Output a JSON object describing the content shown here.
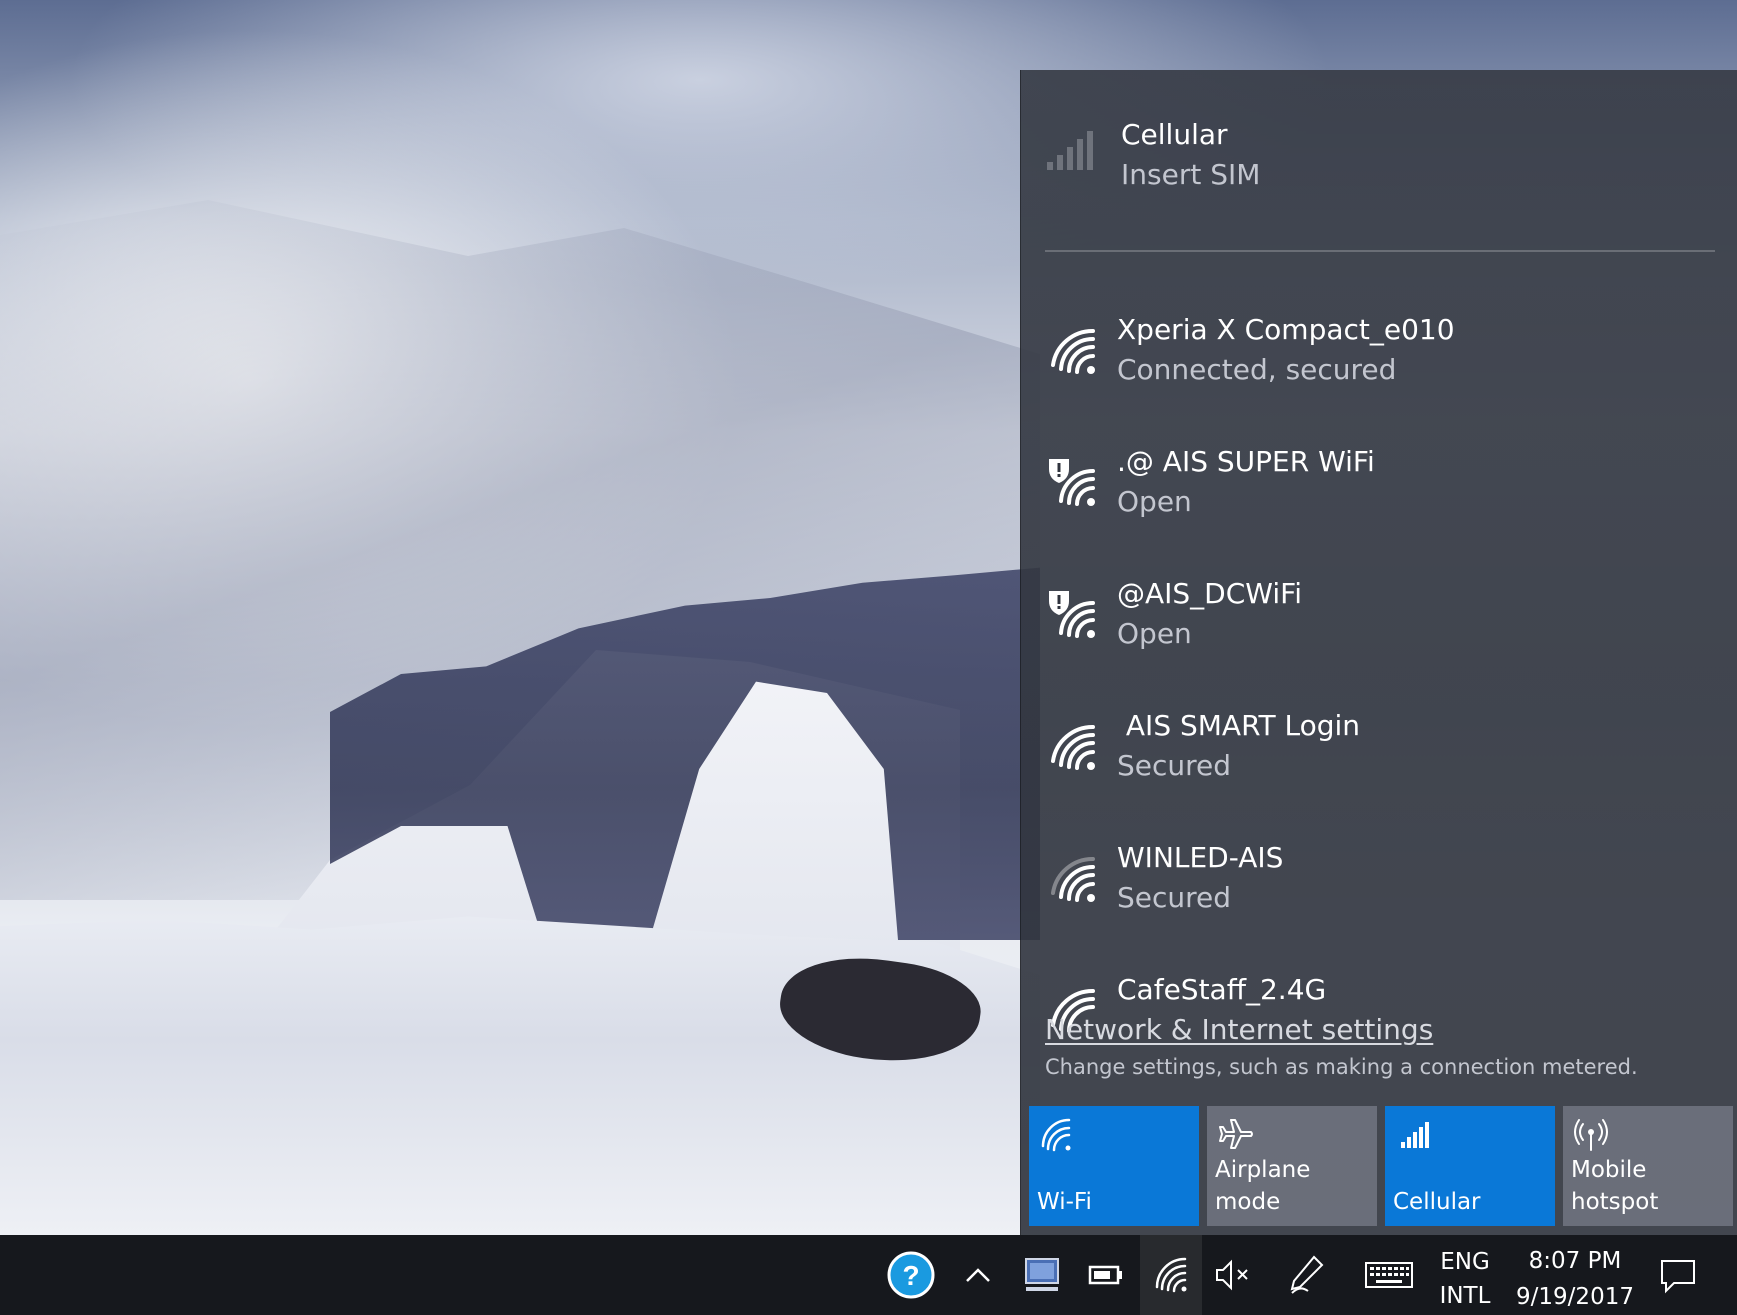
{
  "flyout": {
    "cellular": {
      "name": "Cellular",
      "status": "Insert SIM",
      "icon": "cellular-signal-icon"
    },
    "networks": [
      {
        "name": "Xperia X Compact_e010",
        "status": "Connected, secured",
        "icon": "wifi-icon",
        "warning": false
      },
      {
        "name": ".@ AIS SUPER WiFi",
        "status": "Open",
        "icon": "wifi-open-warning-icon",
        "warning": true
      },
      {
        "name": "@AIS_DCWiFi",
        "status": "Open",
        "icon": "wifi-open-warning-icon",
        "warning": true
      },
      {
        "name": " AIS SMART Login",
        "status": "Secured",
        "icon": "wifi-icon",
        "warning": false
      },
      {
        "name": "WINLED-AIS",
        "status": "Secured",
        "icon": "wifi-icon",
        "warning": false
      },
      {
        "name": "CafeStaff_2.4G",
        "status": "",
        "icon": "wifi-icon",
        "warning": false
      }
    ],
    "settings_link": "Network & Internet settings",
    "settings_desc": "Change settings, such as making a connection metered.",
    "tiles": [
      {
        "label": "Wi-Fi",
        "icon": "wifi-icon",
        "on": true
      },
      {
        "label": "Airplane mode",
        "icon": "airplane-icon",
        "on": false
      },
      {
        "label": "Cellular",
        "icon": "cellular-signal-icon",
        "on": true
      },
      {
        "label": "Mobile hotspot",
        "icon": "hotspot-icon",
        "on": false
      }
    ]
  },
  "taskbar": {
    "icons": [
      "help-icon",
      "chevron-up-icon",
      "display-icon",
      "battery-icon",
      "wifi-icon",
      "volume-muted-icon",
      "pen-icon",
      "keyboard-icon",
      "action-center-icon"
    ],
    "lang_line1": "ENG",
    "lang_line2": "INTL",
    "time": "8:07 PM",
    "date": "9/19/2017"
  },
  "colors": {
    "accent": "#0a78d7",
    "flyout_bg": "#30343e",
    "taskbar_bg": "#16181d"
  }
}
